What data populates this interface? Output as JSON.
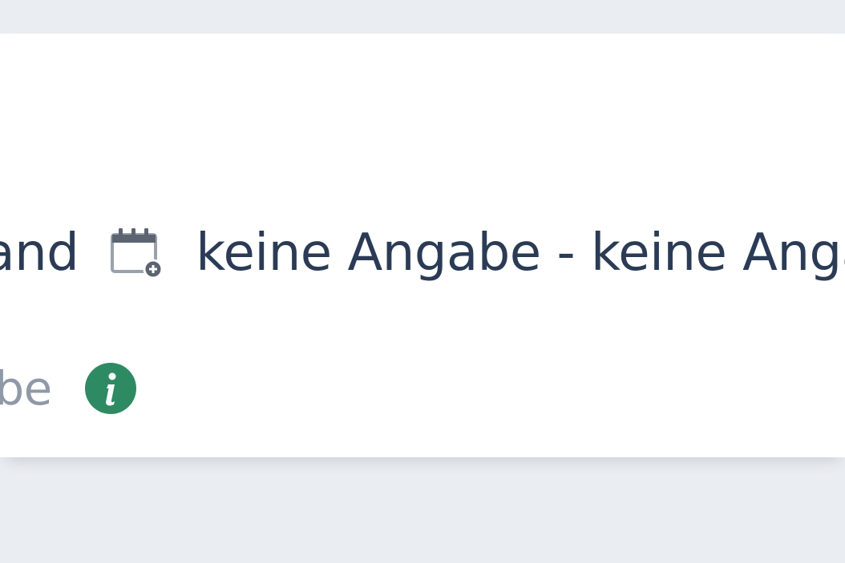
{
  "card": {
    "location_text": "hland",
    "date_range_text": "keine Angabe - keine Angabe",
    "info_text": "gabe"
  },
  "icons": {
    "calendar": "calendar-add-icon",
    "info": "info-icon"
  },
  "colors": {
    "background": "#eaedf1",
    "card": "#ffffff",
    "primary_text": "#2b3b55",
    "muted_text": "#8f99a7",
    "info_green": "#2e8a63"
  }
}
